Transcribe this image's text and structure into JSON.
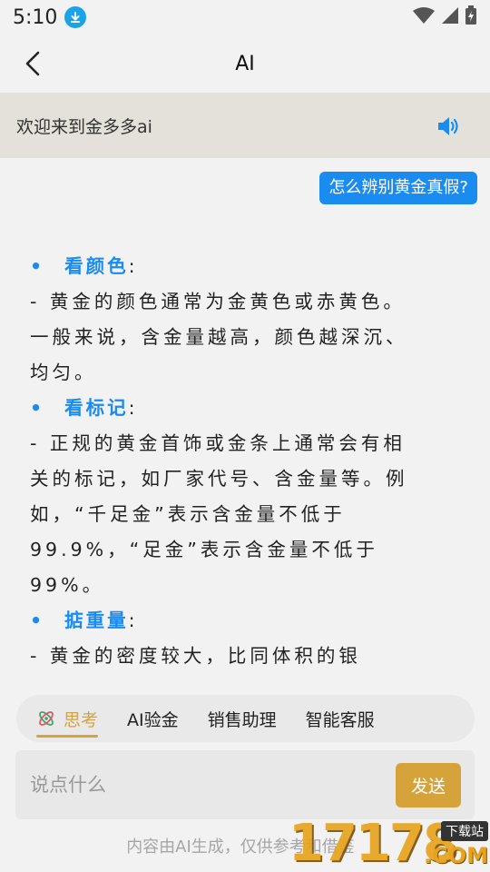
{
  "status_bar": {
    "time": "5:10"
  },
  "header": {
    "title": "AI"
  },
  "welcome": {
    "text": "欢迎来到金多多ai"
  },
  "chat": {
    "user_message": "怎么辨别黄金真假?",
    "answer": {
      "bullet": "•",
      "sections": [
        {
          "heading": "看颜色",
          "colon": ":",
          "lines": [
            "- 黄金的颜色通常为金黄色或赤黄色。",
            "一般来说，含金量越高，颜色越深沉、",
            "均匀。"
          ]
        },
        {
          "heading": "看标记",
          "colon": ":",
          "lines": [
            "- 正规的黄金首饰或金条上通常会有相",
            "关的标记，如厂家代号、含金量等。例",
            "如，“千足金”表示含金量不低于",
            "99.9%，“足金”表示含金量不低于",
            "99%。"
          ]
        },
        {
          "heading": "掂重量",
          "colon": ":",
          "lines": [
            "- 黄金的密度较大，比同体积的银"
          ]
        }
      ]
    }
  },
  "tabs": [
    {
      "label": "思考",
      "active": true
    },
    {
      "label": "AI验金",
      "active": false
    },
    {
      "label": "销售助理",
      "active": false
    },
    {
      "label": "智能客服",
      "active": false
    }
  ],
  "composer": {
    "placeholder": "说点什么",
    "send_label": "发送"
  },
  "footer": {
    "note": "内容由AI生成，仅供参考和借鉴"
  },
  "watermark": {
    "digits": "17178",
    "badge": "下载站",
    "suffix": ".COM"
  },
  "colors": {
    "accent_blue": "#1a8cf0",
    "accent_gold": "#d6a23a",
    "welcome_bg": "#e4e1da"
  }
}
